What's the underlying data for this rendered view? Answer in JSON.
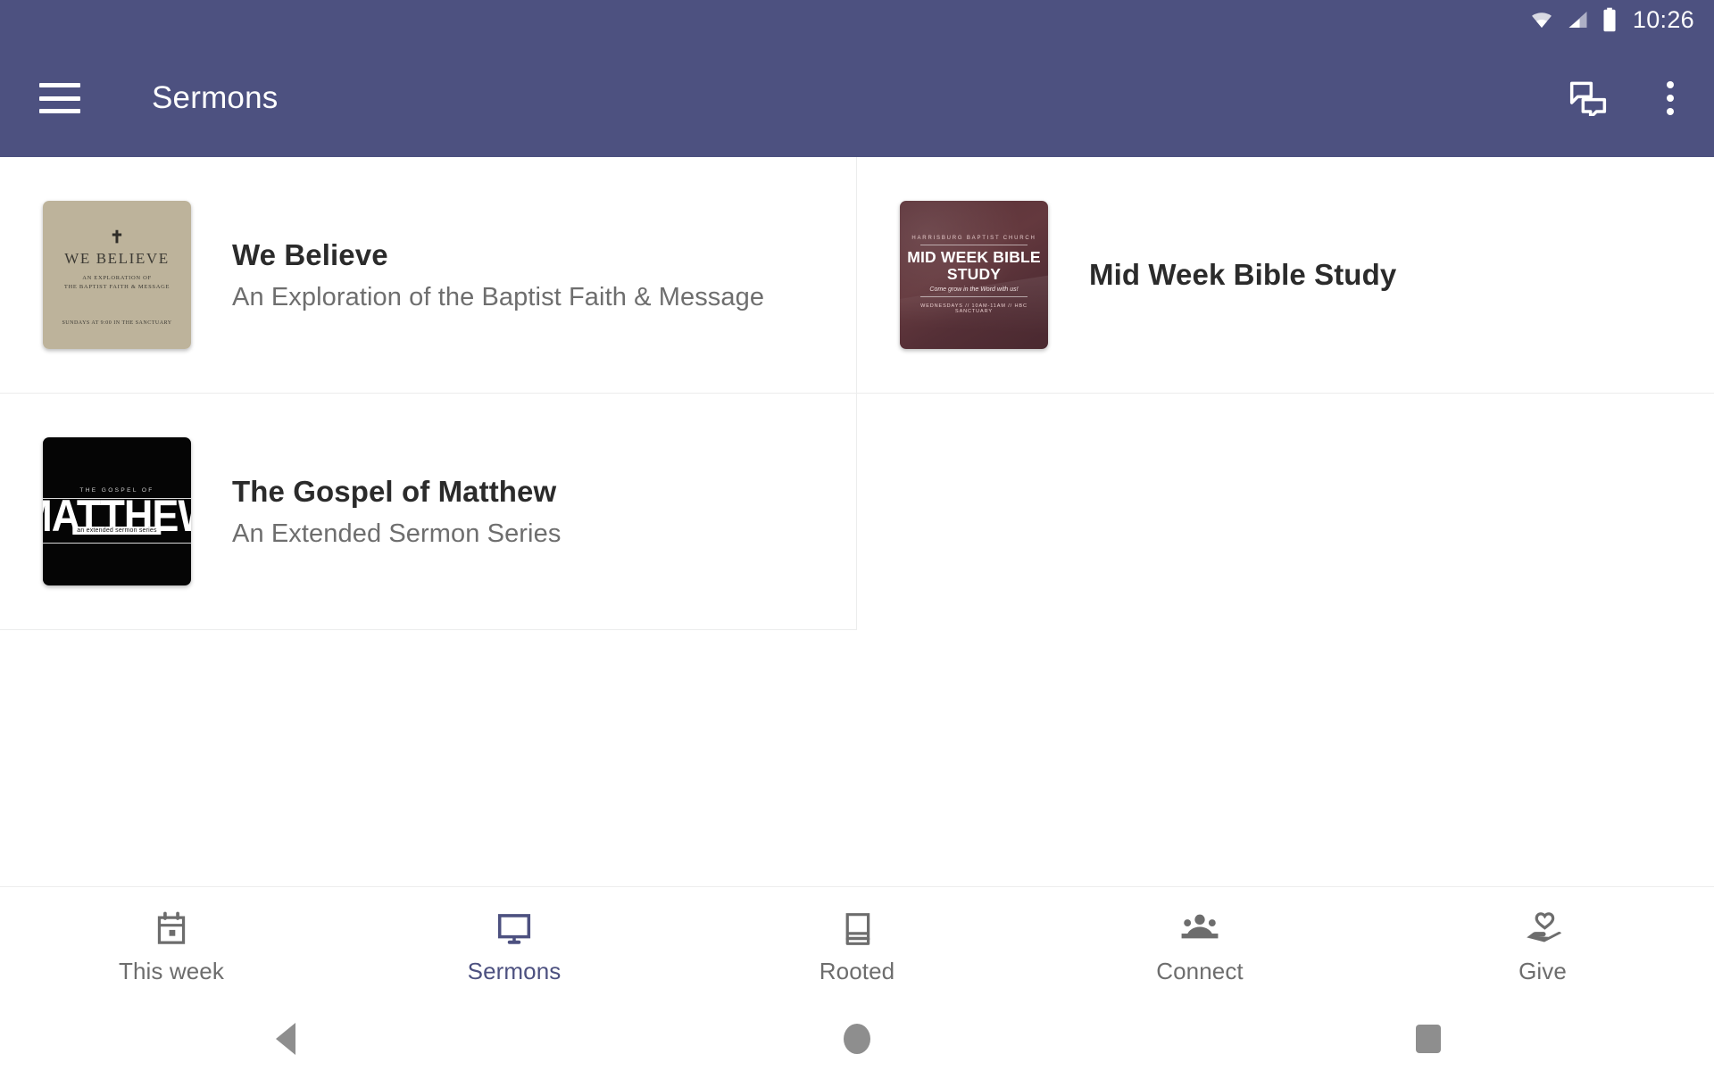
{
  "status_bar": {
    "time": "10:26",
    "icons": [
      "wifi-icon",
      "cellular-signal-icon",
      "battery-icon"
    ]
  },
  "app_bar": {
    "title": "Sermons",
    "menu_icon": "hamburger-menu-icon",
    "actions": [
      {
        "name": "forum-icon",
        "label": "Forum"
      },
      {
        "name": "overflow-menu-icon",
        "label": "More options"
      }
    ],
    "background_color": "#4d5180"
  },
  "sermons": [
    {
      "title": "We Believe",
      "subtitle": "An Exploration of the Baptist Faith & Message",
      "thumbnail": {
        "style": "we-believe",
        "background_color": "#bdb39b",
        "cross": "✝",
        "heading": "WE BELIEVE",
        "subheading_line1": "AN EXPLORATION OF",
        "subheading_line2": "THE BAPTIST FAITH & MESSAGE",
        "footer": "SUNDAYS AT 9:00 IN THE SANCTUARY"
      }
    },
    {
      "title": "Mid Week Bible Study",
      "subtitle": "",
      "thumbnail": {
        "style": "mid-week",
        "background_color": "#5b3238",
        "church": "HARRISBURG BAPTIST CHURCH",
        "heading": "MID WEEK BIBLE STUDY",
        "tagline": "Come grow in the Word with us!",
        "footer": "WEDNESDAYS // 10AM-11AM // HBC SANCTUARY"
      }
    },
    {
      "title": "The Gospel of Matthew",
      "subtitle": "An Extended Sermon Series",
      "thumbnail": {
        "style": "matthew",
        "background_color": "#050505",
        "eyebrow": "THE GOSPEL OF",
        "heading": "MATTHEW",
        "badge": "an extended sermon series"
      }
    }
  ],
  "bottom_nav": {
    "active_color": "#4d5180",
    "inactive_color": "#6d6d6d",
    "items": [
      {
        "label": "This week",
        "icon": "calendar-icon",
        "active": false
      },
      {
        "label": "Sermons",
        "icon": "monitor-icon",
        "active": true
      },
      {
        "label": "Rooted",
        "icon": "book-icon",
        "active": false
      },
      {
        "label": "Connect",
        "icon": "people-group-icon",
        "active": false
      },
      {
        "label": "Give",
        "icon": "hand-heart-icon",
        "active": false
      }
    ]
  },
  "system_nav": {
    "items": [
      {
        "name": "back-button",
        "icon": "triangle-back-icon"
      },
      {
        "name": "home-button",
        "icon": "circle-home-icon"
      },
      {
        "name": "recents-button",
        "icon": "square-recents-icon"
      }
    ]
  }
}
